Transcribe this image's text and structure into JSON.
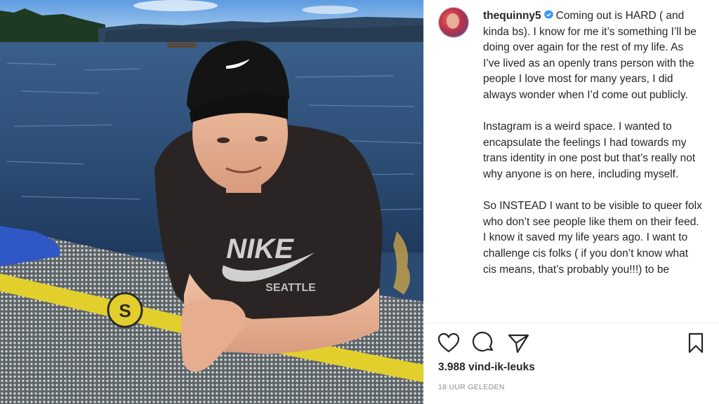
{
  "post": {
    "username": "thequinny5",
    "caption": "Coming out is HARD ( and kinda bs). I know for me it’s something I’ll be doing over again for the rest of my life. As I’ve lived as an openly trans person with the people I love most for many years, I did always wonder when I’d come out publicly.\n\nInstagram is a weird space. I wanted to encapsulate the feelings I had towards my trans identity in one post but that’s really not why anyone is on here, including myself.\n\nSo INSTEAD I want to be visible to queer folx who don’t see people like them on their feed. I know it saved my life years ago. I want to challenge cis folks ( if you don’t know what cis means, that’s probably you!!!) to be",
    "likes": "3.988 vind-ik-leuks",
    "timestamp": "18 UUR GELEDEN",
    "photo_text": {
      "shirt_brand": "NIKE",
      "shirt_city": "SEATTLE"
    }
  },
  "icons": {
    "verified": "verified-badge-icon",
    "like": "heart-icon",
    "comment": "comment-icon",
    "share": "share-icon",
    "save": "bookmark-icon"
  },
  "colors": {
    "verified": "#3897f0",
    "text": "#262626",
    "muted": "#8e8e8e"
  }
}
